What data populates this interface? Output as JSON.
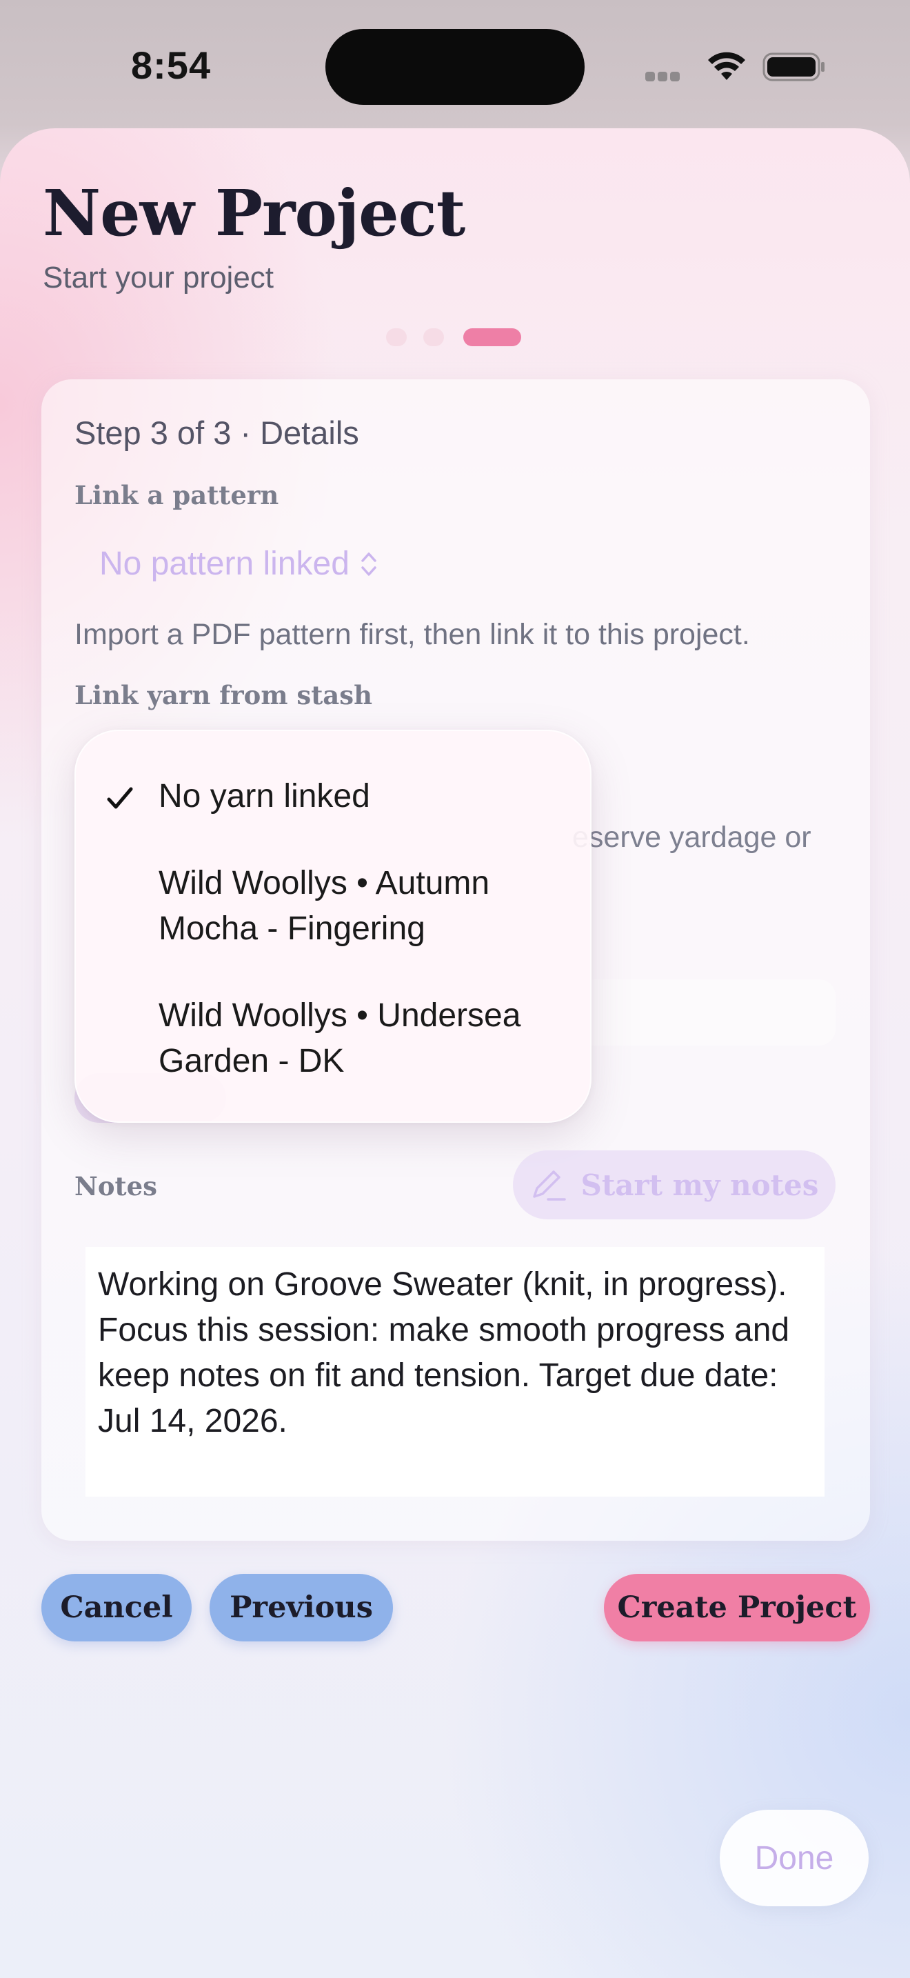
{
  "status_bar": {
    "time": "8:54"
  },
  "header": {
    "title": "New Project",
    "subtitle": "Start your project"
  },
  "pager": {
    "current": 3,
    "total": 3
  },
  "card": {
    "step_label": "Step 3 of 3 · Details",
    "pattern": {
      "label": "Link a pattern",
      "value": "No pattern linked",
      "hint": "Import a PDF pattern first, then link it to this project."
    },
    "yarn": {
      "label": "Link yarn from stash",
      "hint_visible": "eserve yardage or"
    },
    "yarn_menu": {
      "items": [
        {
          "label": "No yarn linked",
          "selected": true
        },
        {
          "label": "Wild Woollys • Autumn Mocha - Fingering",
          "selected": false
        },
        {
          "label": "Wild Woollys • Undersea Garden - DK",
          "selected": false
        }
      ]
    },
    "notes": {
      "label": "Notes",
      "button_label": "Start my notes",
      "text": "Working on Groove Sweater (knit, in progress). Focus this session: make smooth progress and keep notes on fit and tension. Target due date: Jul 14, 2026."
    }
  },
  "actions": {
    "cancel": "Cancel",
    "previous": "Previous",
    "create": "Create Project"
  },
  "keyboard_toolbar": {
    "done": "Done"
  },
  "colors": {
    "accent_pink": "#f07fa5",
    "secondary_blue": "#8fb2ea",
    "placeholder_lavender": "#cbb5ee"
  },
  "icons": [
    "wifi-icon",
    "battery-icon",
    "chevron-up-down-icon",
    "checkmark-icon",
    "pencil-icon"
  ]
}
